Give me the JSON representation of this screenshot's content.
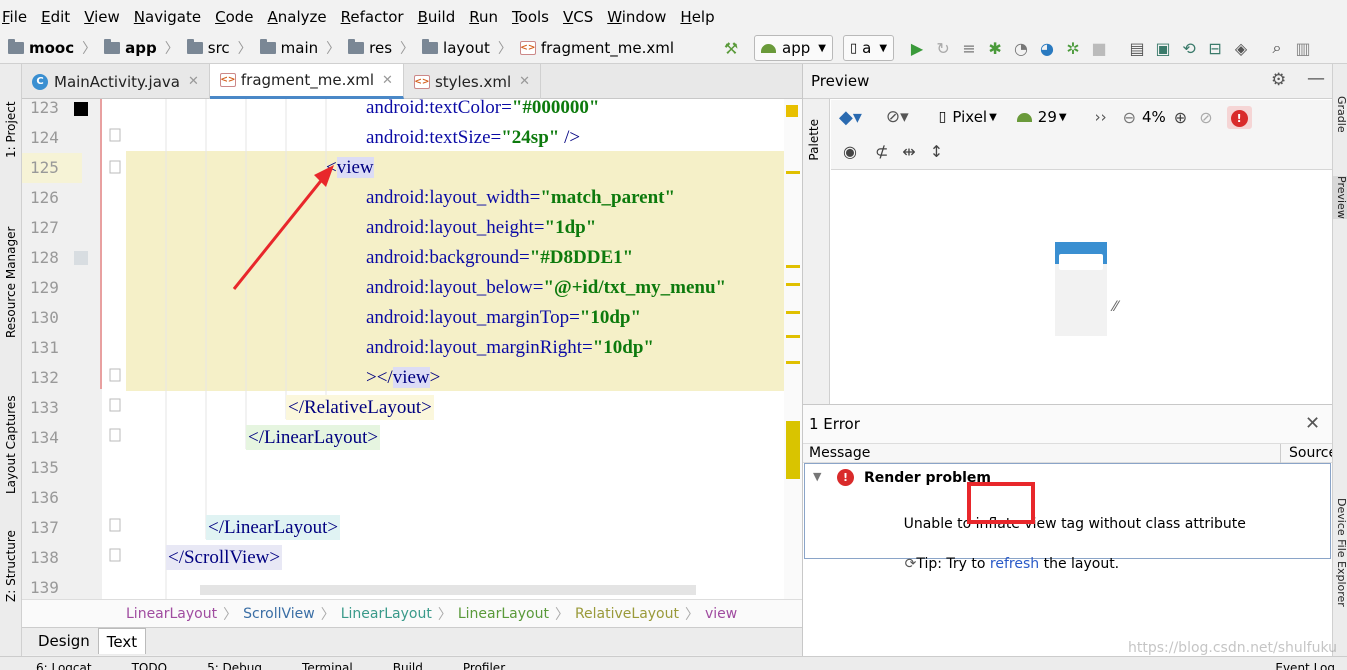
{
  "menu": [
    "File",
    "Edit",
    "View",
    "Navigate",
    "Code",
    "Analyze",
    "Refactor",
    "Build",
    "Run",
    "Tools",
    "VCS",
    "Window",
    "Help"
  ],
  "breadcrumb": [
    "mooc",
    "app",
    "src",
    "main",
    "res",
    "layout",
    "fragment_me.xml"
  ],
  "run_config": {
    "app": "app",
    "device": "a"
  },
  "tabs": [
    {
      "label": "MainActivity.java",
      "icon": "java-class-icon"
    },
    {
      "label": "fragment_me.xml",
      "icon": "xml-file-icon"
    },
    {
      "label": "styles.xml",
      "icon": "xml-file-icon"
    }
  ],
  "left_tools": [
    "1: Project",
    "Resource Manager",
    "Layout Captures",
    "Z: Structure"
  ],
  "line_numbers": [
    "123",
    "124",
    "125",
    "126",
    "127",
    "128",
    "129",
    "130",
    "131",
    "132",
    "133",
    "134",
    "135",
    "136",
    "137",
    "138",
    "139"
  ],
  "code": {
    "l123_attr": "android:textColor=",
    "l123_val": "\"#000000\"",
    "l124_attr": "android:textSize=",
    "l124_val": "\"24sp\"",
    "l124_end": " />",
    "l125_open": "<",
    "l125_tag": "view",
    "l126_attr": "android:layout_width=",
    "l126_val": "\"match_parent\"",
    "l127_attr": "android:layout_height=",
    "l127_val": "\"1dp\"",
    "l128_attr": "android:background=",
    "l128_val": "\"#D8DDE1\"",
    "l129_attr": "android:layout_below=",
    "l129_val": "\"@+id/txt_my_menu\"",
    "l130_attr": "android:layout_marginTop=",
    "l130_val": "\"10dp\"",
    "l131_attr": "android:layout_marginRight=",
    "l131_val": "\"10dp\"",
    "l132_pre": "></",
    "l132_tag": "view",
    "l132_post": ">",
    "l133": "</RelativeLayout>",
    "l134": "</LinearLayout>",
    "l137": "</LinearLayout>",
    "l138": "</ScrollView>"
  },
  "editor_breadcrumb": [
    {
      "label": "LinearLayout",
      "color": "#a04ca0"
    },
    {
      "label": "ScrollView",
      "color": "#3a6ea5"
    },
    {
      "label": "LinearLayout",
      "color": "#3a9a8a"
    },
    {
      "label": "LinearLayout",
      "color": "#5a9a3a"
    },
    {
      "label": "RelativeLayout",
      "color": "#9a9a3a"
    },
    {
      "label": "view",
      "color": "#a04ca0"
    }
  ],
  "mode_tabs": [
    "Design",
    "Text"
  ],
  "bottom_tools": [
    "6: Logcat",
    "TODO",
    "5: Debug",
    "Terminal",
    "Build",
    "Profiler",
    "Event Log"
  ],
  "preview": {
    "title": "Preview",
    "palette_label": "Palette",
    "device": "Pixel",
    "api": "29",
    "zoom": "4%"
  },
  "errors": {
    "count_label": "1 Error",
    "col_message": "Message",
    "col_source": "Source",
    "title": "Render problem",
    "message_pre": "Unable to inflate ",
    "message_hl": "view tag",
    "message_post": " without class attribute",
    "tip_pre": "Tip: Try to ",
    "tip_link": "refresh",
    "tip_post": " the layout."
  },
  "right_tools": [
    "Gradle",
    "Preview",
    "Device File Explorer"
  ],
  "watermark": "https://blog.csdn.net/shulfuku",
  "colors": {
    "accent": "#4a88c7",
    "error": "#d92b2b",
    "highlight": "#f5f0c8",
    "annotation": "#e8272b"
  }
}
